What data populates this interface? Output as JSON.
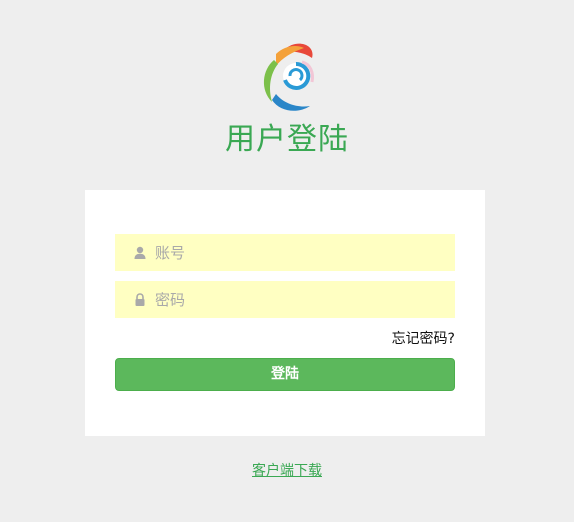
{
  "page": {
    "title": "用户登陆"
  },
  "form": {
    "account_placeholder": "账号",
    "password_placeholder": "密码",
    "account_value": "",
    "password_value": "",
    "forgot_label": "忘记密码?",
    "login_label": "登陆"
  },
  "footer": {
    "download_label": "客户端下载"
  },
  "icons": {
    "logo": "logo-icon",
    "account": "user-icon",
    "password": "lock-icon"
  },
  "colors": {
    "background": "#eeeeee",
    "title": "#3aa853",
    "field_bg": "#ffffc2",
    "button": "#5cb85c",
    "link": "#3aa853"
  }
}
